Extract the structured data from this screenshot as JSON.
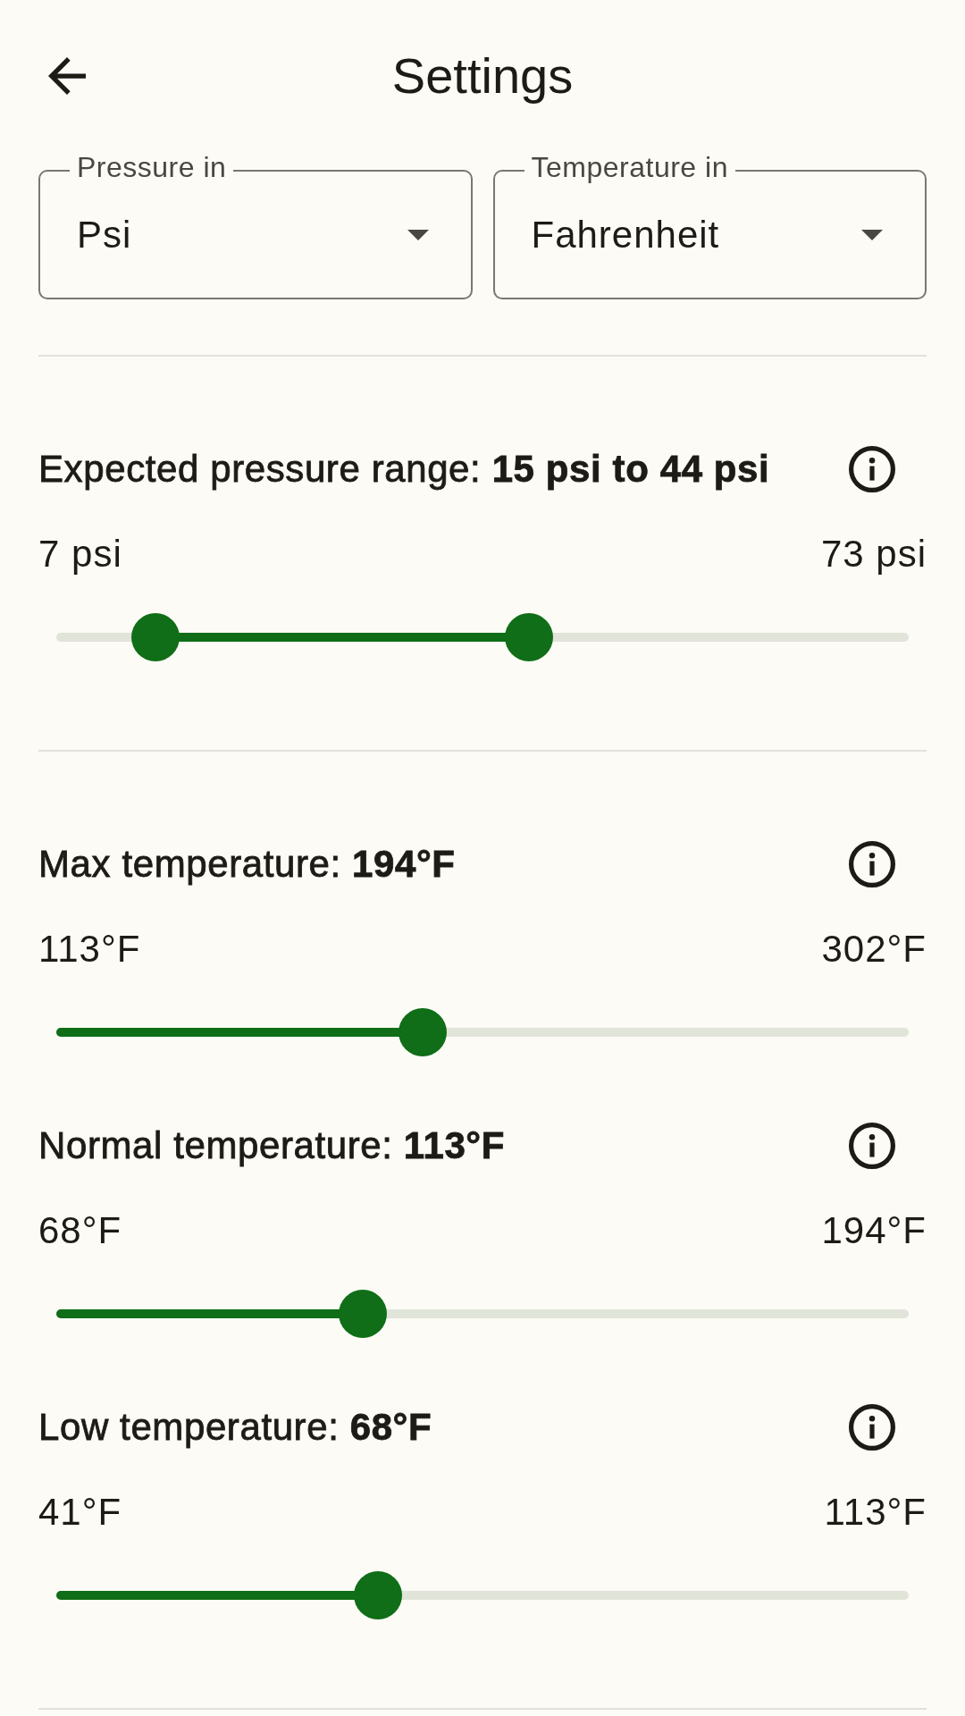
{
  "header": {
    "title": "Settings"
  },
  "dropdowns": [
    {
      "label": "Pressure in",
      "value": "Psi"
    },
    {
      "label": "Temperature in",
      "value": "Fahrenheit"
    }
  ],
  "groups": [
    {
      "settings": [
        {
          "title": "Expected pressure range: **15 psi to 44 psi**",
          "min_label": "7 psi",
          "max_label": "73 psi",
          "slider": {
            "kind": "range",
            "thumbs": [
              {
                "level": 0.116
              },
              {
                "level": 0.555
              }
            ]
          }
        }
      ]
    },
    {
      "settings": [
        {
          "title": "Max temperature: **194°F**",
          "min_label": "113°F",
          "max_label": "302°F",
          "slider": {
            "kind": "single",
            "thumbs": [
              {
                "level": 0.43
              }
            ]
          }
        },
        {
          "title": "Normal temperature: **113°F**",
          "min_label": "68°F",
          "max_label": "194°F",
          "slider": {
            "kind": "single",
            "thumbs": [
              {
                "level": 0.36
              }
            ]
          }
        },
        {
          "title": "Low temperature: **68°F**",
          "min_label": "41°F",
          "max_label": "113°F",
          "slider": {
            "kind": "single",
            "thumbs": [
              {
                "level": 0.377
              }
            ]
          }
        }
      ]
    }
  ]
}
